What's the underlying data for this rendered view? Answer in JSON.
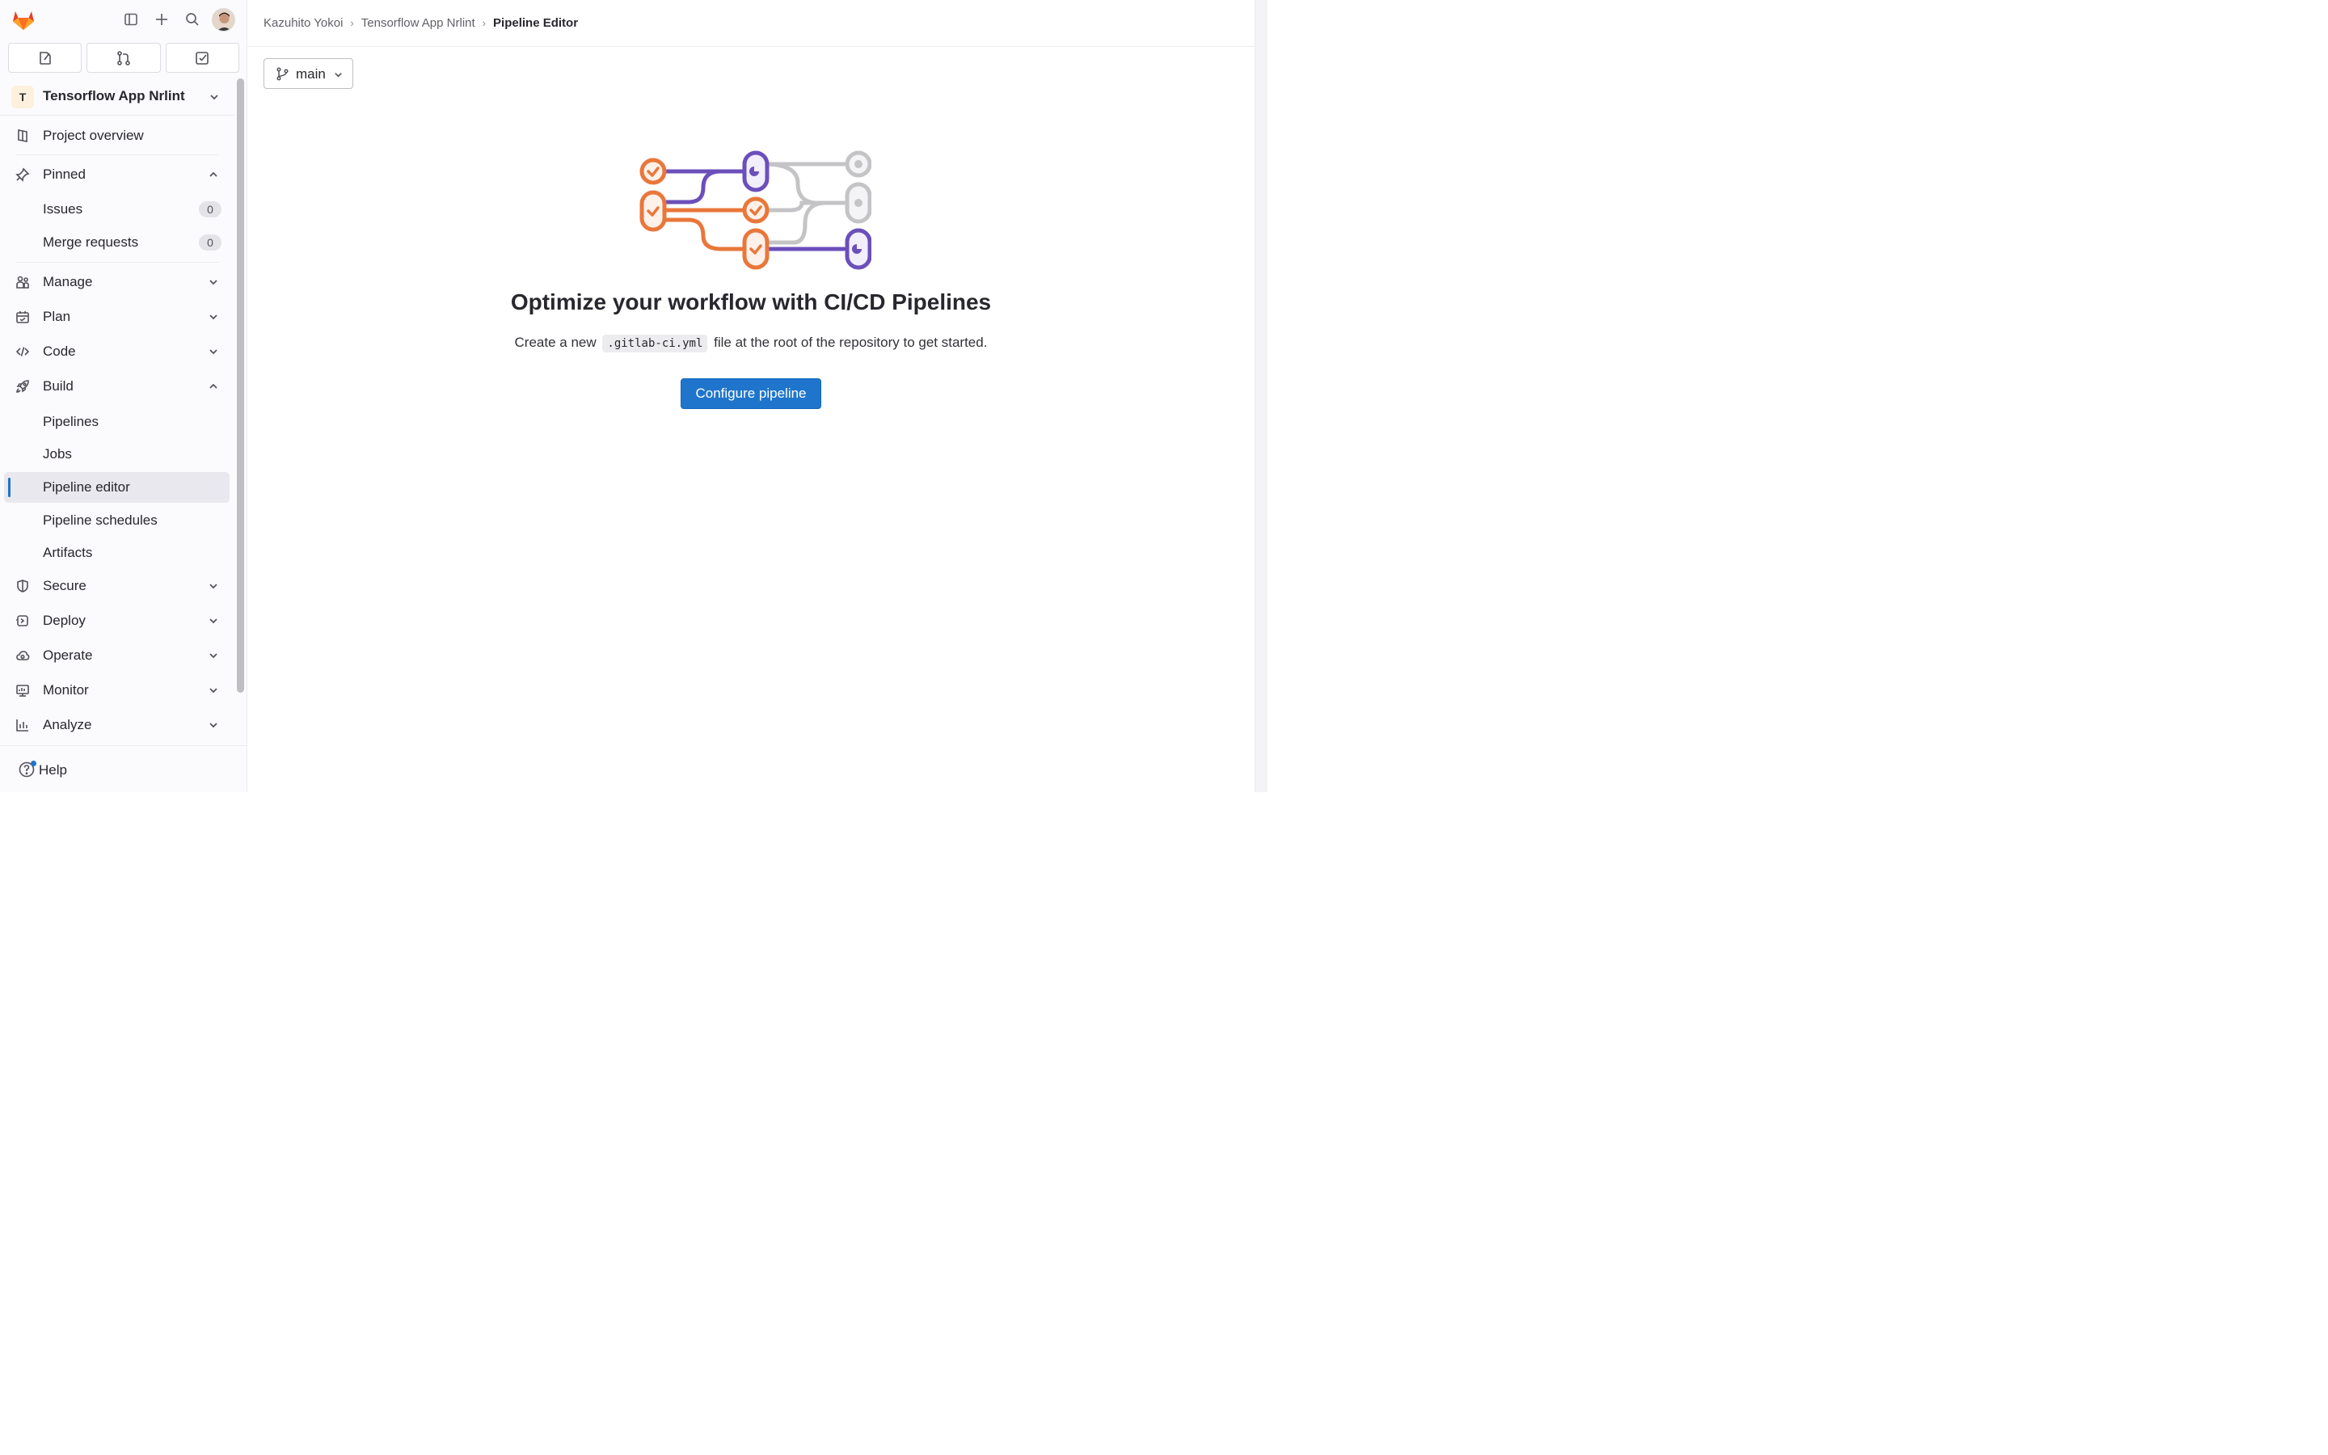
{
  "topbar": {
    "logo_icon": "gitlab-tanuki-icon",
    "sidebar_toggle_icon": "sidebar-toggle-icon",
    "new_icon": "plus-icon",
    "search_icon": "search-icon",
    "avatar_icon": "user-avatar"
  },
  "quick_actions": [
    {
      "icon": "issues-icon"
    },
    {
      "icon": "merge-request-icon"
    },
    {
      "icon": "todo-icon"
    }
  ],
  "project": {
    "initial": "T",
    "name": "Tensorflow App Nrlint"
  },
  "sidebar": {
    "overview": "Project overview",
    "pinned": {
      "label": "Pinned",
      "items": [
        {
          "label": "Issues",
          "count": "0"
        },
        {
          "label": "Merge requests",
          "count": "0"
        }
      ]
    },
    "sections": {
      "manage": "Manage",
      "plan": "Plan",
      "code": "Code",
      "build": "Build",
      "secure": "Secure",
      "deploy": "Deploy",
      "operate": "Operate",
      "monitor": "Monitor",
      "analyze": "Analyze"
    },
    "build_items": [
      "Pipelines",
      "Jobs",
      "Pipeline editor",
      "Pipeline schedules",
      "Artifacts"
    ],
    "active_item": "Pipeline editor",
    "help": "Help"
  },
  "breadcrumb": [
    "Kazuhito Yokoi",
    "Tensorflow App Nrlint",
    "Pipeline Editor"
  ],
  "branch": {
    "label": "main"
  },
  "empty_state": {
    "title": "Optimize your workflow with CI/CD Pipelines",
    "desc_before": "Create a new",
    "code": ".gitlab-ci.yml",
    "desc_after": "file at the root of the repository to get started.",
    "button": "Configure pipeline"
  },
  "colors": {
    "accent": "#1f75cb",
    "orange": "#e9773b",
    "purple": "#6b4fbb",
    "gray": "#c4c4c7"
  }
}
